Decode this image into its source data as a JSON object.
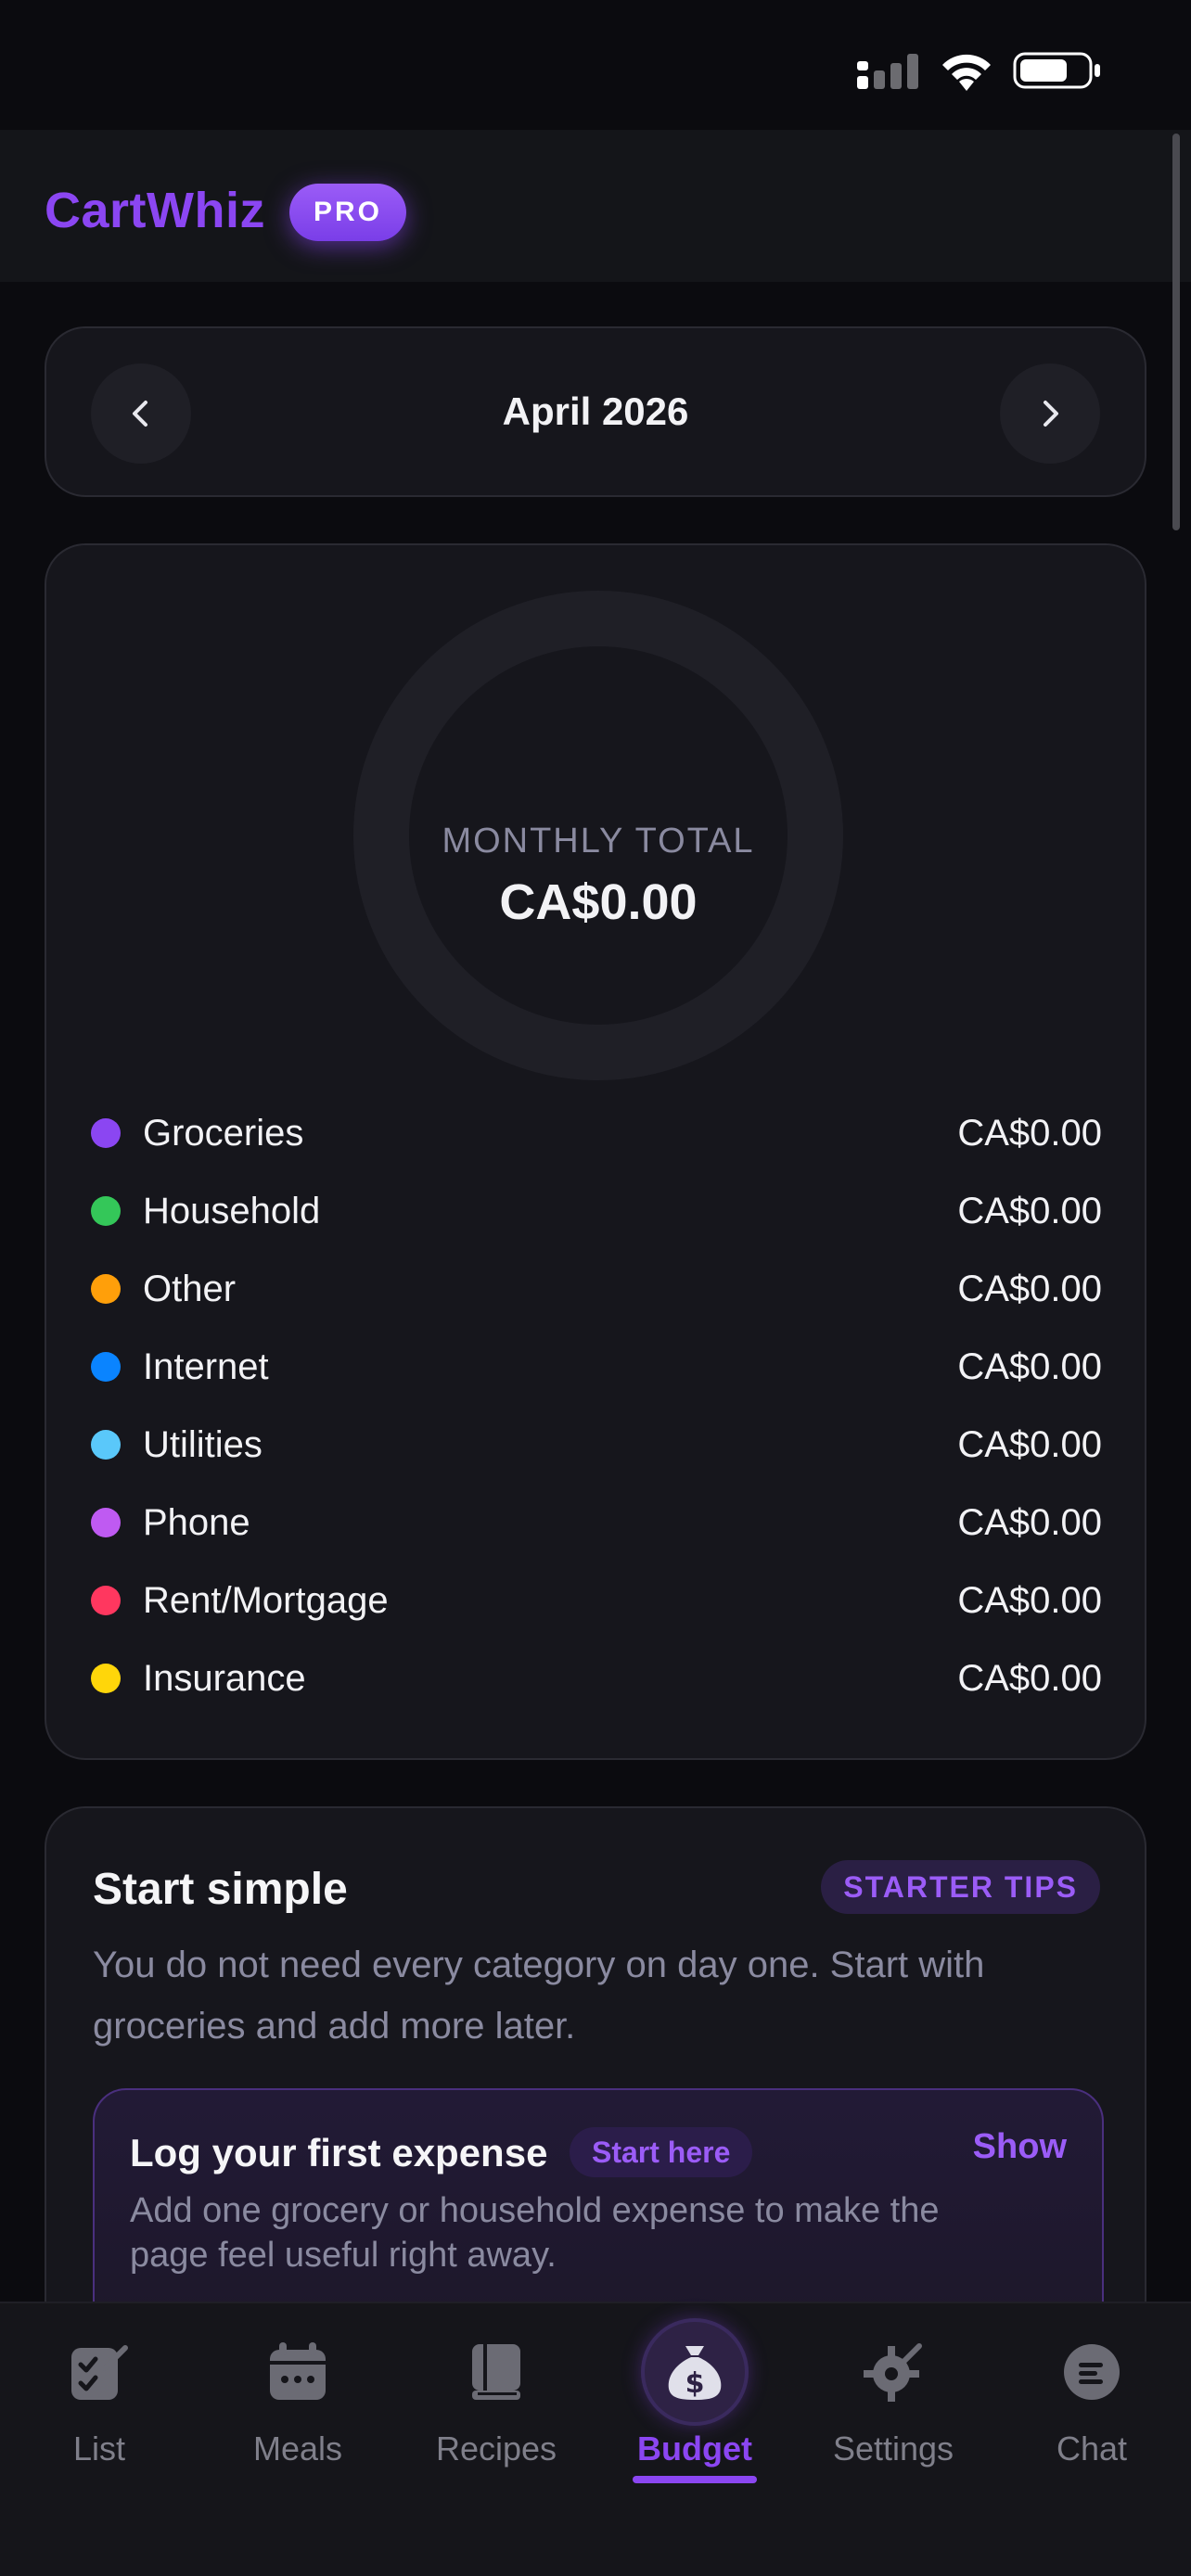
{
  "app": {
    "name": "CartWhiz",
    "badge": "PRO"
  },
  "month_selector": {
    "label": "April 2026"
  },
  "summary": {
    "ring_label": "MONTHLY TOTAL",
    "total": "CA$0.00",
    "categories": [
      {
        "name": "Groceries",
        "amount": "CA$0.00",
        "color": "#8b46f2"
      },
      {
        "name": "Household",
        "amount": "CA$0.00",
        "color": "#34c759"
      },
      {
        "name": "Other",
        "amount": "CA$0.00",
        "color": "#ff9f0a"
      },
      {
        "name": "Internet",
        "amount": "CA$0.00",
        "color": "#0a84ff"
      },
      {
        "name": "Utilities",
        "amount": "CA$0.00",
        "color": "#5ac8fa"
      },
      {
        "name": "Phone",
        "amount": "CA$0.00",
        "color": "#bf5af2"
      },
      {
        "name": "Rent/Mortgage",
        "amount": "CA$0.00",
        "color": "#ff375f"
      },
      {
        "name": "Insurance",
        "amount": "CA$0.00",
        "color": "#ffd60a"
      }
    ]
  },
  "tips": {
    "title": "Start simple",
    "tag": "STARTER TIPS",
    "description": "You do not need every category on day one. Start with groceries and add more later.",
    "first_expense": {
      "title": "Log your first expense",
      "chip": "Start here",
      "action": "Show",
      "description": "Add one grocery or household expense to make the page feel useful right away."
    }
  },
  "tabs": [
    {
      "label": "List",
      "icon": "checklist-icon",
      "active": false
    },
    {
      "label": "Meals",
      "icon": "calendar-icon",
      "active": false
    },
    {
      "label": "Recipes",
      "icon": "book-icon",
      "active": false
    },
    {
      "label": "Budget",
      "icon": "money-bag-icon",
      "active": true
    },
    {
      "label": "Settings",
      "icon": "gear-icon",
      "active": false
    },
    {
      "label": "Chat",
      "icon": "chat-bubble-icon",
      "active": false
    }
  ],
  "colors": {
    "accent": "#8b46f2",
    "background": "#0b0b0f",
    "card": "#16161c"
  }
}
